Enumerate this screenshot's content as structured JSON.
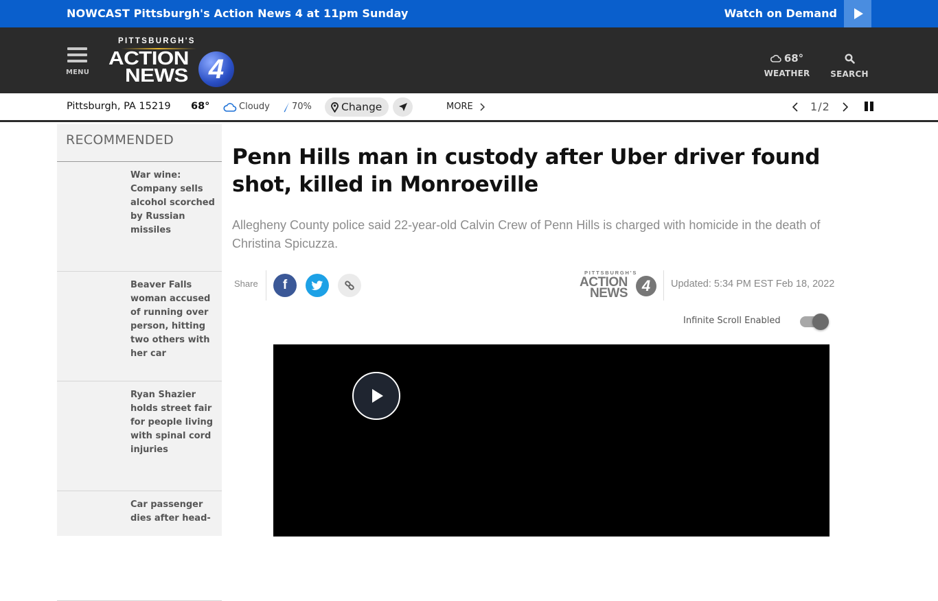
{
  "promo": {
    "kicker": "NOWCAST",
    "text": "Pittsburgh's Action News 4 at 11pm Sunday",
    "watch_label": "Watch on Demand",
    "accent_color": "#0a5fcc"
  },
  "header": {
    "menu_label": "MENU",
    "logo": {
      "line1": "PITTSBURGH'S",
      "line2": "ACTION",
      "line3": "NEWS",
      "channel": "4"
    },
    "weather": {
      "temp": "68°",
      "label": "WEATHER",
      "icon": "cloud-icon"
    },
    "search": {
      "label": "SEARCH",
      "icon": "search-icon"
    }
  },
  "weather_bar": {
    "location": "Pittsburgh, PA 15219",
    "temp": "68°",
    "condition": "Cloudy",
    "precip": "70%",
    "change_label": "Change",
    "more_label": "MORE",
    "pager": {
      "current": "1",
      "separator": "/",
      "total": "2"
    }
  },
  "sidebar": {
    "title": "RECOMMENDED",
    "items": [
      {
        "title": "War wine: Company sells alcohol scorched by Russian missiles"
      },
      {
        "title": "Beaver Falls woman accused of running over person, hitting two others with her car"
      },
      {
        "title": "Ryan Shazier holds street fair for people living with spinal cord injuries"
      },
      {
        "title": "Car passenger dies after head-"
      }
    ]
  },
  "article": {
    "headline": "Penn Hills man in custody after Uber driver found shot, killed in Monroeville",
    "dek": "Allegheny County police said 22-year-old Calvin Crew of Penn Hills is charged with homicide in the death of Christina Spicuzza.",
    "share_label": "Share",
    "share_buttons": [
      {
        "name": "facebook",
        "color": "#3b5897"
      },
      {
        "name": "twitter",
        "color": "#1da1e6"
      },
      {
        "name": "copy-link",
        "color": "#ebebeb"
      }
    ],
    "source_logo": {
      "line1": "PITTSBURGH'S",
      "line2": "ACTION",
      "line3": "NEWS",
      "channel": "4"
    },
    "updated": "Updated: 5:34 PM EST Feb 18, 2022",
    "infinite_scroll_label": "Infinite Scroll Enabled",
    "infinite_scroll_enabled": true
  }
}
